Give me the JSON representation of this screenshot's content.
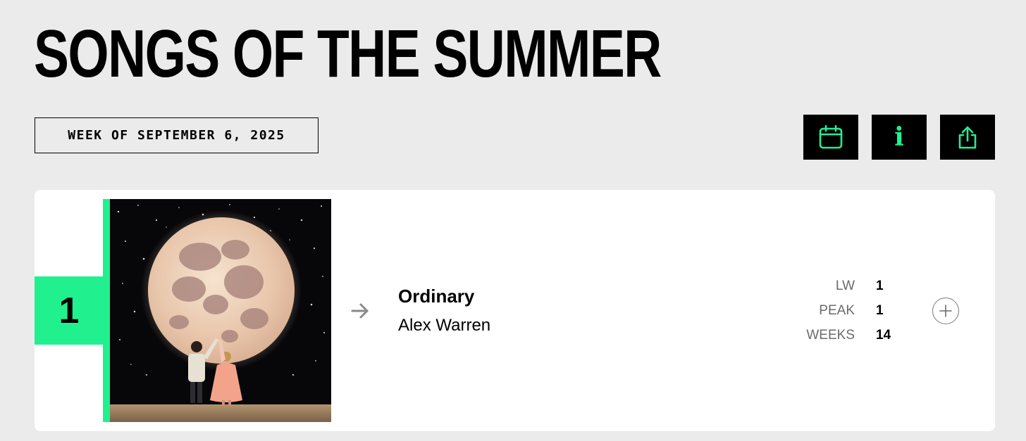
{
  "header": {
    "title": "SONGS OF THE SUMMER",
    "week_label": "WEEK OF SEPTEMBER 6, 2025"
  },
  "toolbar": {
    "calendar_icon": "calendar-icon",
    "info_icon": "info-icon",
    "info_glyph": "i",
    "share_icon": "share-icon"
  },
  "chart": {
    "entries": [
      {
        "rank": "1",
        "title": "Ordinary",
        "artist": "Alex Warren",
        "trend_icon": "arrow-right-icon",
        "stats": {
          "lw_label": "LW",
          "lw_value": "1",
          "peak_label": "PEAK",
          "peak_value": "1",
          "weeks_label": "WEEKS",
          "weeks_value": "14"
        },
        "expand_icon": "plus-icon"
      }
    ]
  },
  "colors": {
    "accent": "#21f08f",
    "page_background": "#ebebeb",
    "card_background": "#ffffff",
    "button_background": "#000000",
    "muted_text": "#6b6b6b",
    "trend_icon": "#8a8a8a"
  }
}
